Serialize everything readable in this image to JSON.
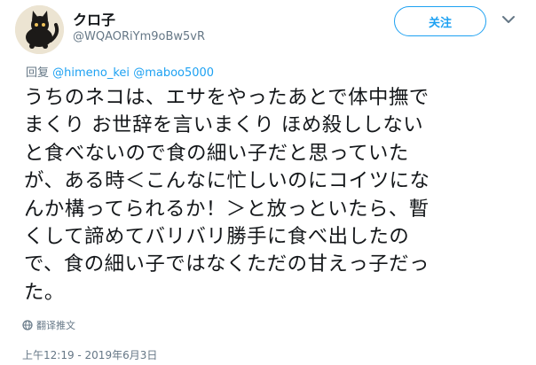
{
  "author": {
    "display_name": "クロ子",
    "handle": "@WQAORiYm9oBw5vR"
  },
  "follow_label": "关注",
  "reply": {
    "prefix": "回复",
    "mention_1": "@himeno_kei",
    "mention_2": "@maboo5000"
  },
  "tweet_lines": [
    "うちのネコは、エサをやったあとで体中撫で",
    "まくり お世辞を言いまくり ほめ殺ししない",
    "と食べないので食の細い子だと思っていた",
    "が、ある時＜こんなに忙しいのにコイツにな",
    "んか構ってられるか！＞と放っといたら、暫",
    "くして諦めてバリバリ勝手に食べ出したの",
    "で、食の細い子ではなくただの甘えっ子だっ",
    "た。"
  ],
  "translate_label": "翻译推文",
  "timestamp": "上午12:19 - 2019年6月3日",
  "colors": {
    "accent": "#1da1f2",
    "muted": "#657786",
    "text": "#14171a"
  },
  "icons": {
    "avatar": "black-cat-avatar",
    "caret": "chevron-down-icon",
    "translate": "globe-icon"
  }
}
